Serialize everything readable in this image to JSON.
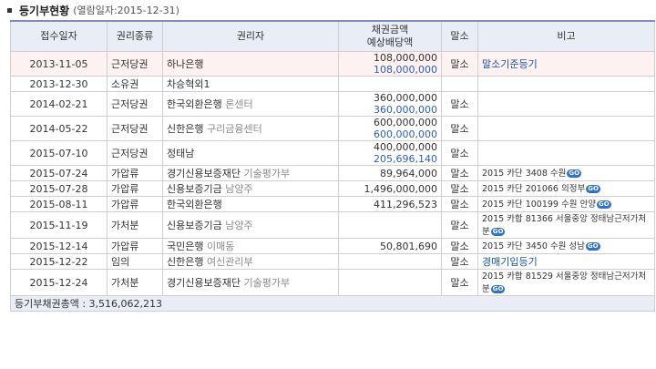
{
  "header": {
    "title": "등기부현황",
    "subtitle": "(열람일자:2015-12-31)"
  },
  "columns": {
    "date": "접수일자",
    "type": "권리종류",
    "holder": "권리자",
    "amount_line1": "채권금액",
    "amount_line2": "예상배당액",
    "cancel": "말소",
    "remarks": "비고"
  },
  "rows": [
    {
      "date": "2013-11-05",
      "type": "근저당권",
      "holder": "하나은행",
      "sub": "",
      "amount": "108,000,000",
      "expected": "108,000,000",
      "cancel": "말소",
      "remarks": "말소기준등기",
      "go": ""
    },
    {
      "date": "2013-12-30",
      "type": "소유권",
      "holder": "차승혁외1",
      "sub": "",
      "amount": "",
      "expected": "",
      "cancel": "",
      "remarks": "",
      "go": ""
    },
    {
      "date": "2014-02-21",
      "type": "근저당권",
      "holder": "한국외환은행",
      "sub": "론센터",
      "amount": "360,000,000",
      "expected": "360,000,000",
      "cancel": "말소",
      "remarks": "",
      "go": ""
    },
    {
      "date": "2014-05-22",
      "type": "근저당권",
      "holder": "신한은행",
      "sub": "구리금융센터",
      "amount": "600,000,000",
      "expected": "600,000,000",
      "cancel": "말소",
      "remarks": "",
      "go": ""
    },
    {
      "date": "2015-07-10",
      "type": "근저당권",
      "holder": "정태남",
      "sub": "",
      "amount": "400,000,000",
      "expected": "205,696,140",
      "cancel": "말소",
      "remarks": "",
      "go": ""
    },
    {
      "date": "2015-07-24",
      "type": "가압류",
      "holder": "경기신용보증재단",
      "sub": "기술평가부",
      "amount": "89,964,000",
      "expected": "",
      "cancel": "말소",
      "remarks": "2015 카단 3408 수원",
      "go": "GO"
    },
    {
      "date": "2015-07-28",
      "type": "가압류",
      "holder": "신용보증기금",
      "sub": "남양주",
      "amount": "1,496,000,000",
      "expected": "",
      "cancel": "말소",
      "remarks": "2015 카단 201066 의정부",
      "go": "GO"
    },
    {
      "date": "2015-08-11",
      "type": "가압류",
      "holder": "한국외환은행",
      "sub": "",
      "amount": "411,296,523",
      "expected": "",
      "cancel": "말소",
      "remarks": "2015 카단 100199 수원 안양",
      "go": "GO"
    },
    {
      "date": "2015-11-19",
      "type": "가처분",
      "holder": "신용보증기금",
      "sub": "남양주",
      "amount": "",
      "expected": "",
      "cancel": "말소",
      "remarks": "2015 카합 81366 서울중앙 정태남근저가처분",
      "go": "GO"
    },
    {
      "date": "2015-12-14",
      "type": "가압류",
      "holder": "국민은행",
      "sub": "이매동",
      "amount": "50,801,690",
      "expected": "",
      "cancel": "말소",
      "remarks": "2015 카단 3450 수원 성남",
      "go": "GO"
    },
    {
      "date": "2015-12-22",
      "type": "임의",
      "holder": "신한은행",
      "sub": "여신관리부",
      "amount": "",
      "expected": "",
      "cancel": "말소",
      "remarks": "경매기입등기",
      "go": ""
    },
    {
      "date": "2015-12-24",
      "type": "가처분",
      "holder": "경기신용보증재단",
      "sub": "기술평가부",
      "amount": "",
      "expected": "",
      "cancel": "말소",
      "remarks": "2015 카합 81529 서울중앙 정태남근저가처분",
      "go": "GO"
    }
  ],
  "total": {
    "label": "등기부채권총액 :",
    "value": "3,516,062,213"
  },
  "colors": {
    "header_bg": "#e9edf6",
    "highlight_row": "#fdf1f1",
    "link": "#1a53b0",
    "go_badge": "#2f72c8"
  }
}
